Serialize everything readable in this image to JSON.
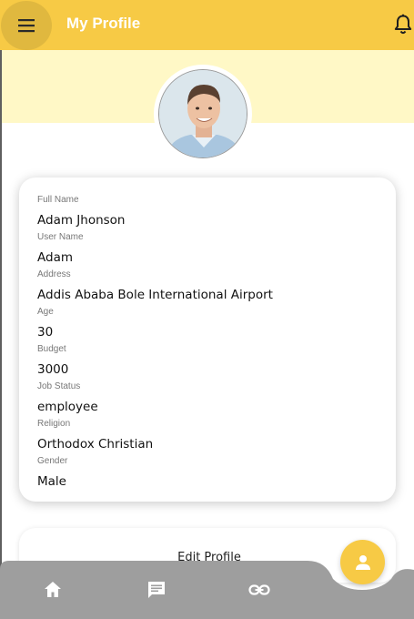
{
  "header": {
    "title": "My Profile",
    "menu_icon": "menu-icon",
    "notification_icon": "bell-icon"
  },
  "colors": {
    "accent": "#F7CA45",
    "band": "#FFF8C6",
    "nav": "#9E9E9E"
  },
  "profile": {
    "avatar": "profile-photo",
    "fields": [
      {
        "label": "Full Name",
        "value": "Adam Jhonson"
      },
      {
        "label": "User Name",
        "value": "Adam"
      },
      {
        "label": "Address",
        "value": "Addis Ababa Bole International Airport"
      },
      {
        "label": "Age",
        "value": "30"
      },
      {
        "label": "Budget",
        "value": "3000"
      },
      {
        "label": "Job Status",
        "value": "employee"
      },
      {
        "label": "Religion",
        "value": "Orthodox Christian"
      },
      {
        "label": "Gender",
        "value": "Male"
      }
    ]
  },
  "actions": {
    "edit_label": "Edit Profile"
  },
  "bottom_nav": {
    "items": [
      {
        "icon": "home-icon"
      },
      {
        "icon": "chat-icon"
      },
      {
        "icon": "link-icon"
      }
    ],
    "active_icon": "person-icon"
  }
}
